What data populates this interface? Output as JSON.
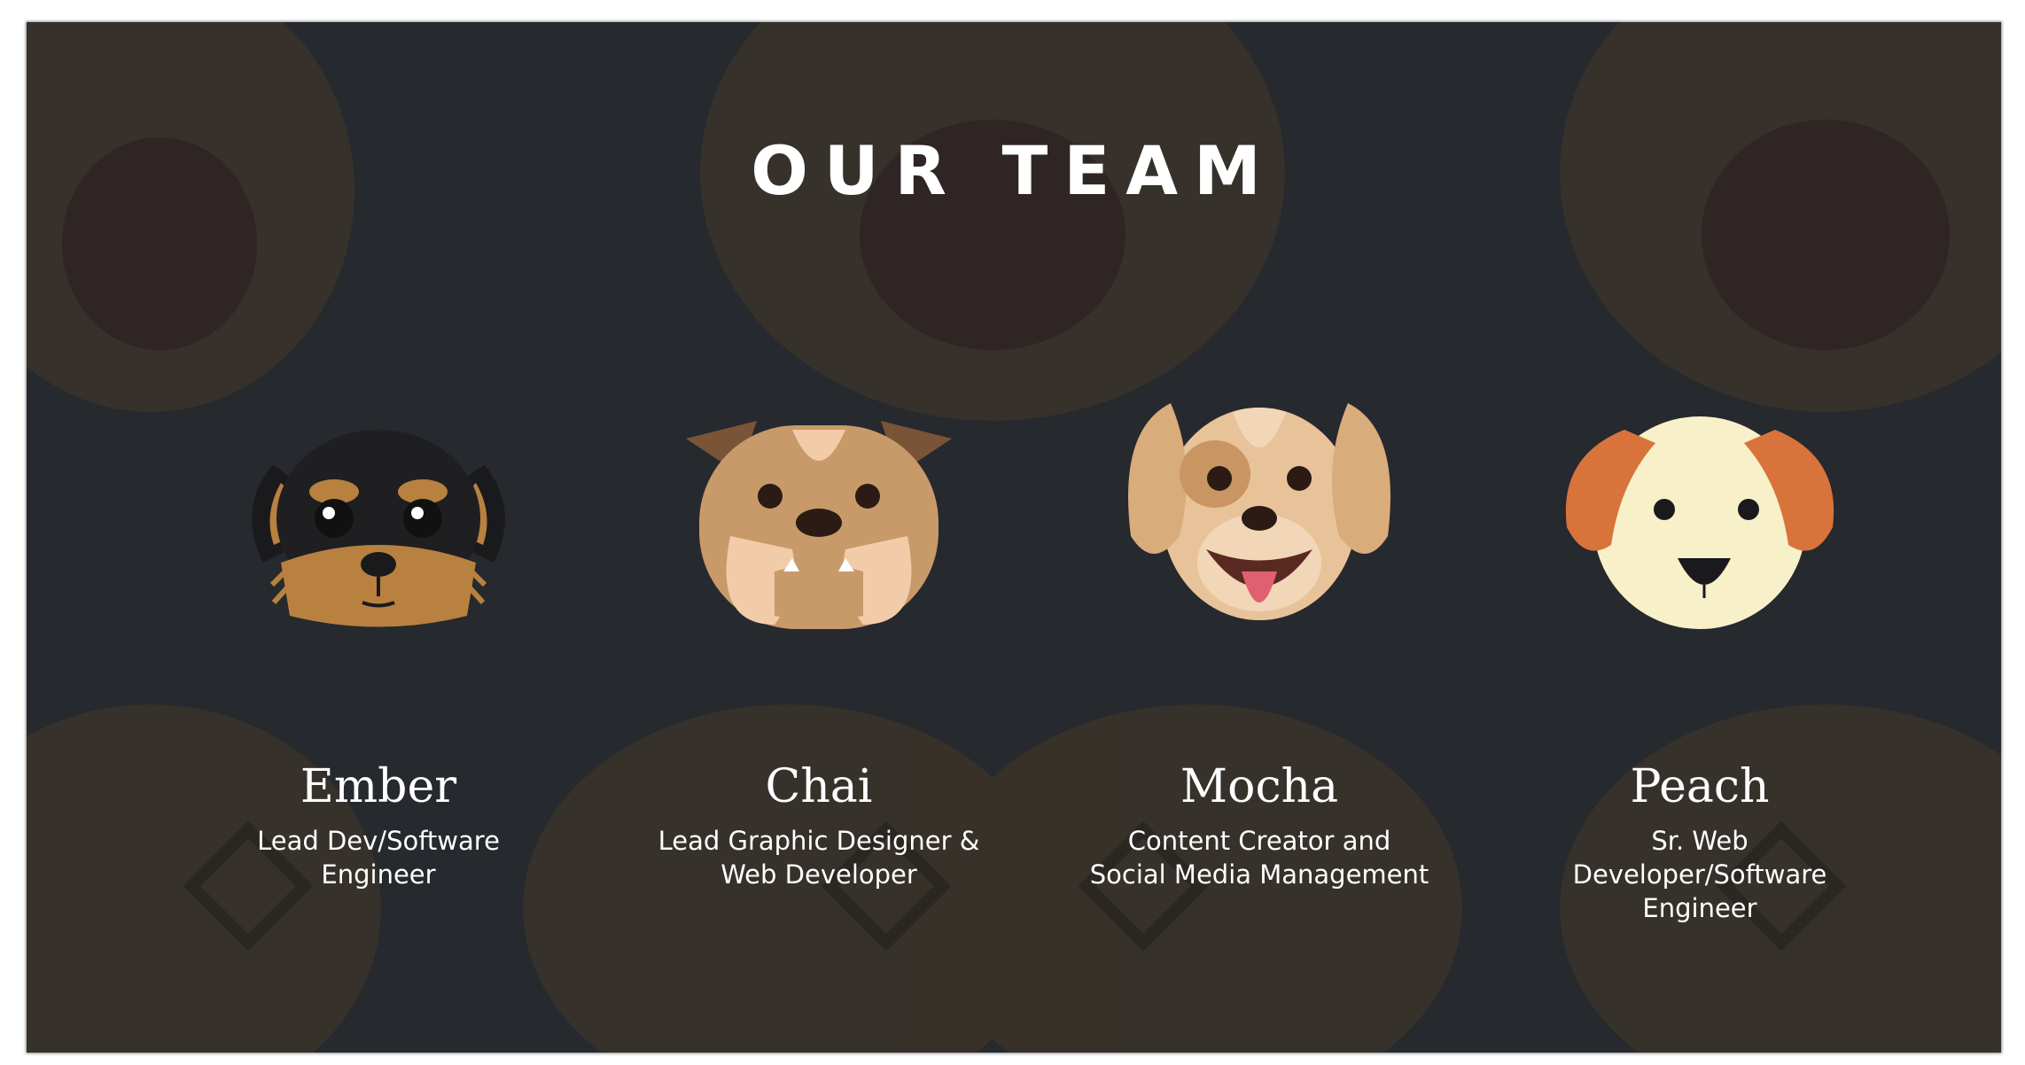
{
  "section": {
    "title": "OUR TEAM"
  },
  "colors": {
    "background": "#26292e",
    "pattern": "#3a332a",
    "text": "#ffffff"
  },
  "members": [
    {
      "name": "Ember",
      "role": "Lead Dev/Software\nEngineer",
      "avatar_icon": "rottweiler-puppy-icon"
    },
    {
      "name": "Chai",
      "role": "Lead Graphic Designer &\nWeb Developer",
      "avatar_icon": "bulldog-icon"
    },
    {
      "name": "Mocha",
      "role": "Content Creator and\nSocial Media Management",
      "avatar_icon": "retriever-icon"
    },
    {
      "name": "Peach",
      "role": "Sr. Web\nDeveloper/Software\nEngineer",
      "avatar_icon": "cream-puppy-icon"
    }
  ]
}
